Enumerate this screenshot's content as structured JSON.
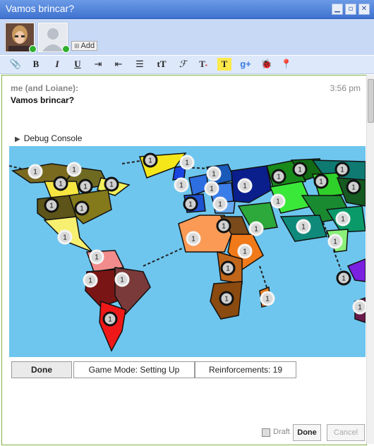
{
  "window": {
    "title": "Vamos brincar?",
    "controls": {
      "minimize": "▁",
      "maximize": "▫",
      "close": "✕"
    }
  },
  "participants": {
    "add_label": "Add",
    "status_color": "#2fb02f"
  },
  "toolbar": {
    "items": [
      "attach-icon",
      "bold",
      "italic",
      "underline",
      "indent",
      "outdent",
      "bullet-list",
      "font-size",
      "font",
      "text-color",
      "highlight",
      "google-plus-icon",
      "bug-icon",
      "map-pin-icon"
    ]
  },
  "blip": {
    "author": "me (and Loiane):",
    "time": "3:56 pm",
    "message": "Vamos brincar?"
  },
  "gadget": {
    "debug_label": "Debug Console",
    "done_label": "Done",
    "game_mode": "Game Mode: Setting Up",
    "reinforcements": "Reinforcements: 19",
    "army_count": "1"
  },
  "footer": {
    "draft_label": "Draft",
    "done_label": "Done",
    "cancel_label": "Cancel"
  },
  "colors": {
    "titlebar": "#3f73d0",
    "participants_bg": "#c8d9f6",
    "ocean": "#6ec6ee",
    "blip_border": "#7cb342"
  }
}
